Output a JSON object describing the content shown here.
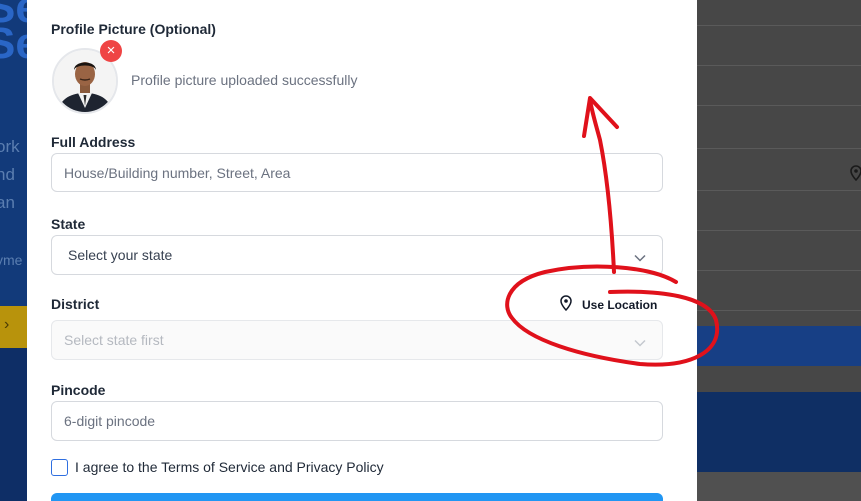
{
  "background": {
    "left_fragments": [
      "Se",
      "ork",
      "nd",
      "an",
      "yme"
    ]
  },
  "form": {
    "profile_picture_label": "Profile Picture (Optional)",
    "upload_status": "Profile picture uploaded successfully",
    "remove_icon": "×",
    "full_address_label": "Full Address",
    "full_address_placeholder": "House/Building number, Street, Area",
    "state_label": "State",
    "state_value": "Select your state",
    "district_label": "District",
    "use_location_label": "Use Location",
    "district_value": "Select state first",
    "pincode_label": "Pincode",
    "pincode_placeholder": "6-digit pincode",
    "terms_label": "I agree to the Terms of Service and Privacy Policy"
  },
  "colors": {
    "remove_button": "#ef4444",
    "submit_button": "#2196f3",
    "annotation": "#e0111b"
  },
  "icons": [
    "close-icon",
    "chevron-down-icon",
    "map-pin-icon"
  ]
}
